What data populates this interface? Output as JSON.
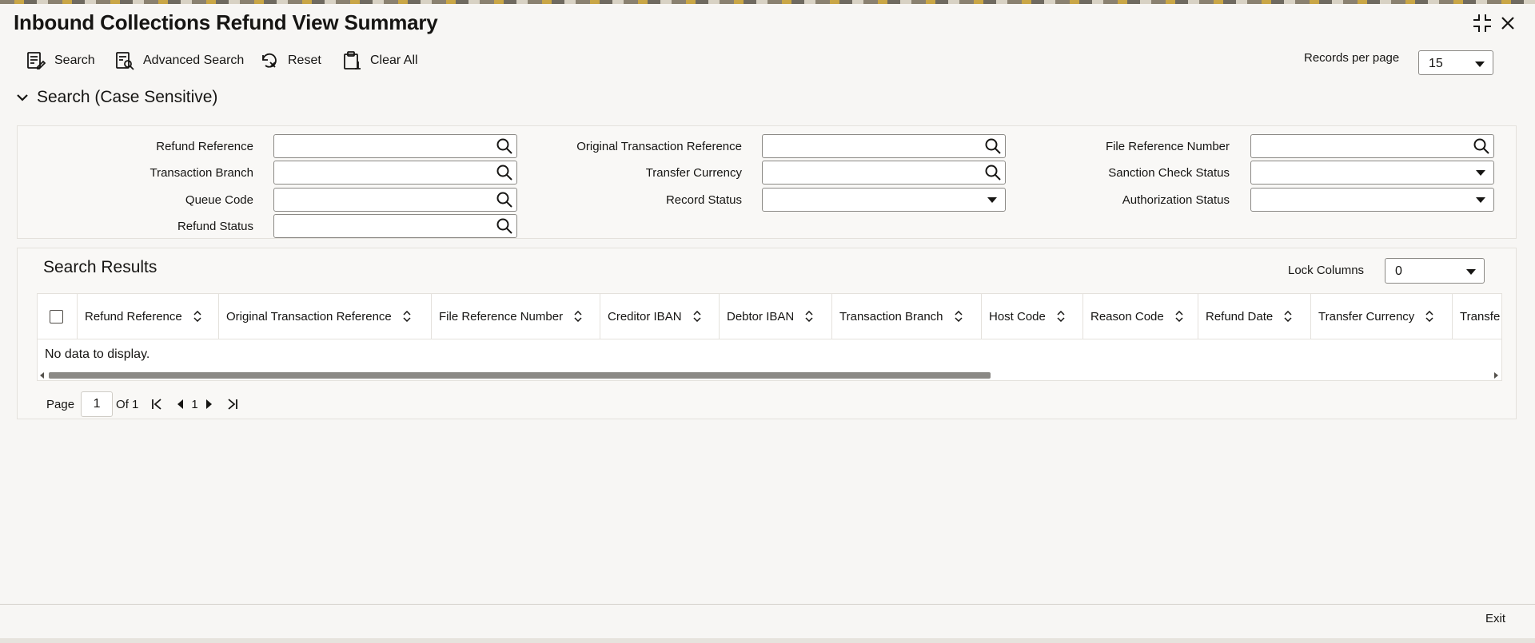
{
  "window": {
    "title": "Inbound Collections Refund View Summary"
  },
  "toolbar": {
    "search_label": "Search",
    "advanced_search_label": "Advanced Search",
    "reset_label": "Reset",
    "clear_all_label": "Clear All"
  },
  "records_per_page": {
    "label": "Records per page",
    "value": "15"
  },
  "search_section": {
    "title": "Search (Case Sensitive)",
    "fields": {
      "refund_reference": "Refund Reference",
      "transaction_branch": "Transaction Branch",
      "queue_code": "Queue Code",
      "refund_status": "Refund Status",
      "original_transaction_reference": "Original Transaction Reference",
      "transfer_currency": "Transfer Currency",
      "record_status": "Record Status",
      "file_reference_number": "File Reference Number",
      "sanction_check_status": "Sanction Check Status",
      "authorization_status": "Authorization Status"
    }
  },
  "results": {
    "title": "Search Results",
    "lock_columns_label": "Lock Columns",
    "lock_columns_value": "0",
    "columns": [
      "Refund Reference",
      "Original Transaction Reference",
      "File Reference Number",
      "Creditor IBAN",
      "Debtor IBAN",
      "Transaction Branch",
      "Host Code",
      "Reason Code",
      "Refund Date",
      "Transfer Currency",
      "Transfe"
    ],
    "empty_text": "No data to display."
  },
  "pager": {
    "page_label": "Page",
    "page_value": "1",
    "of_label": "Of 1",
    "current": "1"
  },
  "footer": {
    "exit_label": "Exit"
  }
}
